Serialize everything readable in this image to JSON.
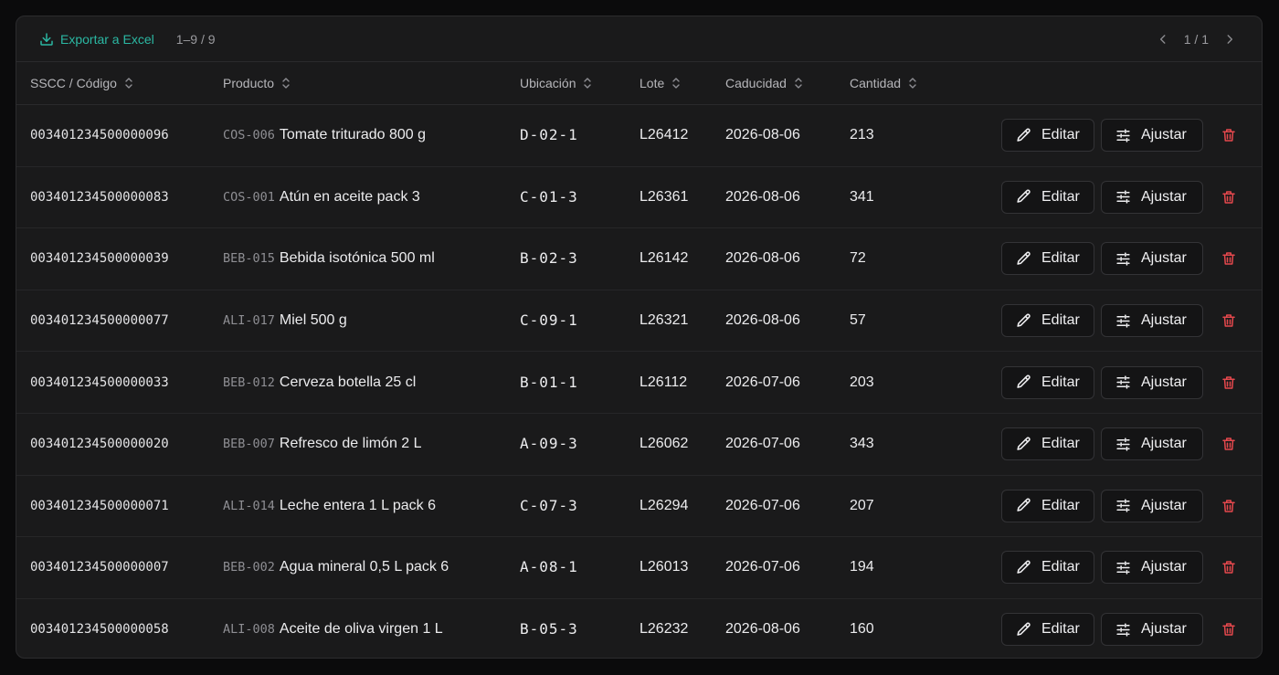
{
  "toolbar": {
    "export_label": "Exportar a Excel",
    "range_label": "1–9 / 9",
    "page_label": "1 / 1"
  },
  "colors": {
    "accent": "#2bb8a3",
    "danger": "#e5484d"
  },
  "columns": [
    "SSCC / Código",
    "Producto",
    "Ubicación",
    "Lote",
    "Caducidad",
    "Cantidad"
  ],
  "actions": {
    "edit_label": "Editar",
    "adjust_label": "Ajustar"
  },
  "rows": [
    {
      "sscc": "003401234500000096",
      "code": "COS-006",
      "product": "Tomate triturado 800 g",
      "location": "D-02-1",
      "lot": "L26412",
      "expiry": "2026-08-06",
      "qty": "213"
    },
    {
      "sscc": "003401234500000083",
      "code": "COS-001",
      "product": "Atún en aceite pack 3",
      "location": "C-01-3",
      "lot": "L26361",
      "expiry": "2026-08-06",
      "qty": "341"
    },
    {
      "sscc": "003401234500000039",
      "code": "BEB-015",
      "product": "Bebida isotónica 500 ml",
      "location": "B-02-3",
      "lot": "L26142",
      "expiry": "2026-08-06",
      "qty": "72"
    },
    {
      "sscc": "003401234500000077",
      "code": "ALI-017",
      "product": "Miel 500 g",
      "location": "C-09-1",
      "lot": "L26321",
      "expiry": "2026-08-06",
      "qty": "57"
    },
    {
      "sscc": "003401234500000033",
      "code": "BEB-012",
      "product": "Cerveza botella 25 cl",
      "location": "B-01-1",
      "lot": "L26112",
      "expiry": "2026-07-06",
      "qty": "203"
    },
    {
      "sscc": "003401234500000020",
      "code": "BEB-007",
      "product": "Refresco de limón 2 L",
      "location": "A-09-3",
      "lot": "L26062",
      "expiry": "2026-07-06",
      "qty": "343"
    },
    {
      "sscc": "003401234500000071",
      "code": "ALI-014",
      "product": "Leche entera 1 L pack 6",
      "location": "C-07-3",
      "lot": "L26294",
      "expiry": "2026-07-06",
      "qty": "207"
    },
    {
      "sscc": "003401234500000007",
      "code": "BEB-002",
      "product": "Agua mineral 0,5 L pack 6",
      "location": "A-08-1",
      "lot": "L26013",
      "expiry": "2026-07-06",
      "qty": "194"
    },
    {
      "sscc": "003401234500000058",
      "code": "ALI-008",
      "product": "Aceite de oliva virgen 1 L",
      "location": "B-05-3",
      "lot": "L26232",
      "expiry": "2026-08-06",
      "qty": "160"
    }
  ]
}
